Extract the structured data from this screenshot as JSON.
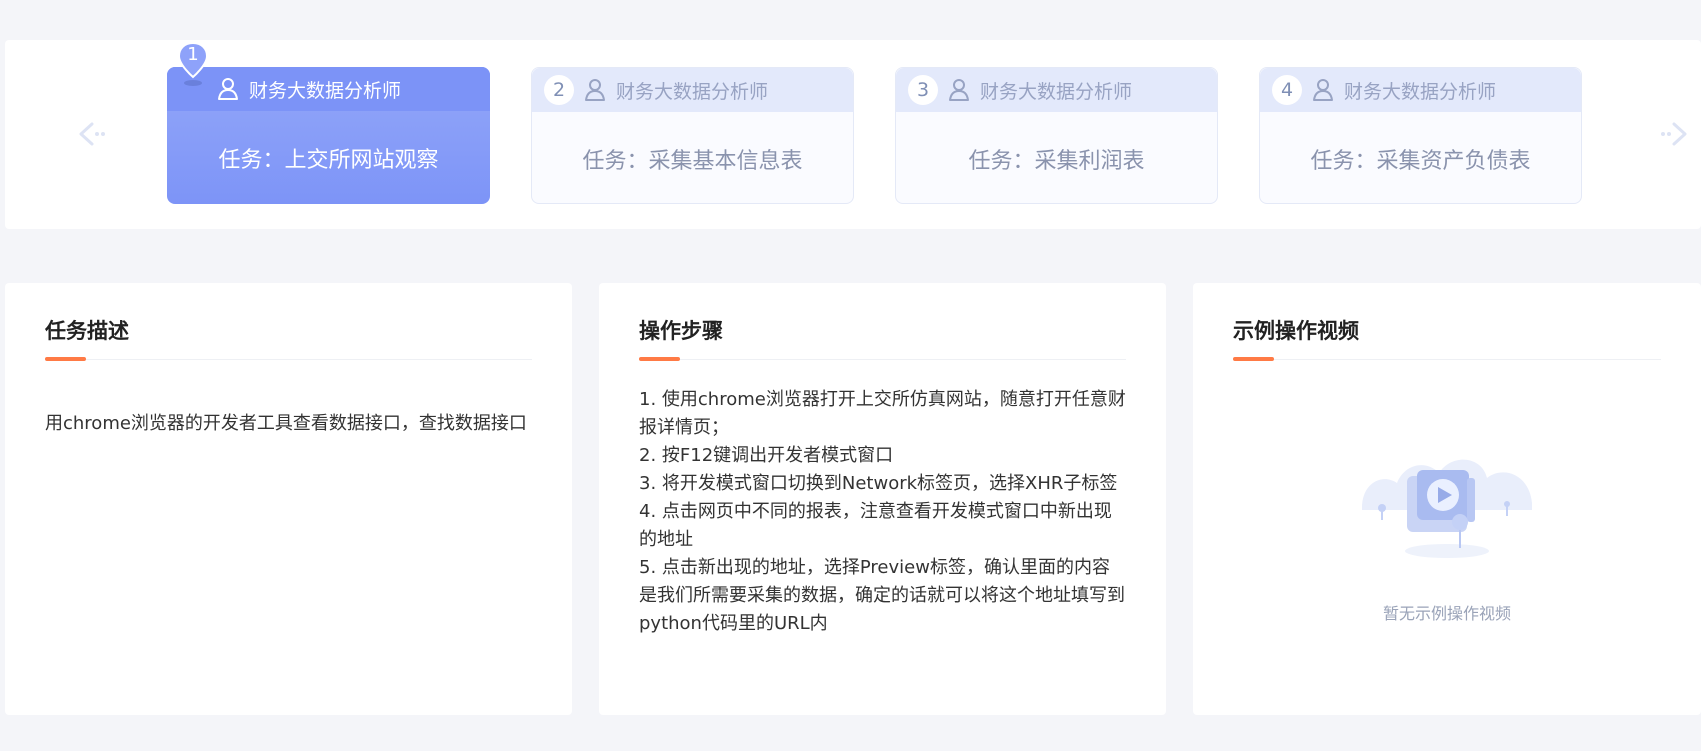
{
  "stepper": {
    "prev_icon": "chevron-left-icon",
    "next_icon": "chevron-right-icon",
    "steps": [
      {
        "number": "1",
        "role": "财务大数据分析师",
        "task": "任务：上交所网站观察",
        "state": "active"
      },
      {
        "number": "2",
        "role": "财务大数据分析师",
        "task": "任务：采集基本信息表",
        "state": "inactive"
      },
      {
        "number": "3",
        "role": "财务大数据分析师",
        "task": "任务：采集利润表",
        "state": "inactive"
      },
      {
        "number": "4",
        "role": "财务大数据分析师",
        "task": "任务：采集资产负债表",
        "state": "inactive"
      }
    ]
  },
  "task_description": {
    "title": "任务描述",
    "body": "用chrome浏览器的开发者工具查看数据接口，查找数据接口"
  },
  "operation_steps": {
    "title": "操作步骤",
    "items": [
      "1. 使用chrome浏览器打开上交所仿真网站，随意打开任意财报详情页；",
      "2. 按F12键调出开发者模式窗口",
      "3. 将开发模式窗口切换到Network标签页，选择XHR子标签",
      "4. 点击网页中不同的报表，注意查看开发模式窗口中新出现的地址",
      "5. 点击新出现的地址，选择Preview标签，确认里面的内容是我们所需要采集的数据，确定的话就可以将这个地址填写到python代码里的URL内"
    ]
  },
  "example_video": {
    "title": "示例操作视频",
    "empty_text": "暂无示例操作视频",
    "empty_icon": "video-empty-illustration-icon"
  },
  "colors": {
    "accent": "#ff7a45",
    "active_step": "#7c93f7",
    "background": "#f4f5f9"
  }
}
